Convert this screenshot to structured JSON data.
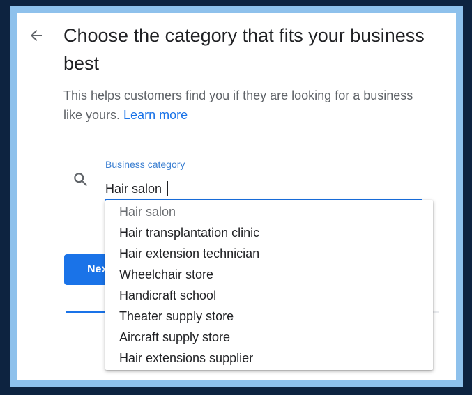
{
  "page": {
    "title": "Choose the category that fits your business best",
    "description": "This helps customers find you if they are looking for a business like yours.",
    "learn_more": "Learn more"
  },
  "field": {
    "label": "Business category",
    "value": "Hair salon"
  },
  "next_button": {
    "label": "Next"
  },
  "progress": {
    "fraction": 0.11
  },
  "suggestions": [
    "Hair salon",
    "Hair transplantation clinic",
    "Hair extension technician",
    "Wheelchair store",
    "Handicraft school",
    "Theater supply store",
    "Aircraft supply store",
    "Hair extensions supplier"
  ],
  "colors": {
    "accent": "#1a73e8",
    "frame": "#0d2340",
    "frame_border": "#8ec1ec"
  },
  "icons": {
    "back": "arrow-back-icon",
    "search": "search-icon"
  }
}
